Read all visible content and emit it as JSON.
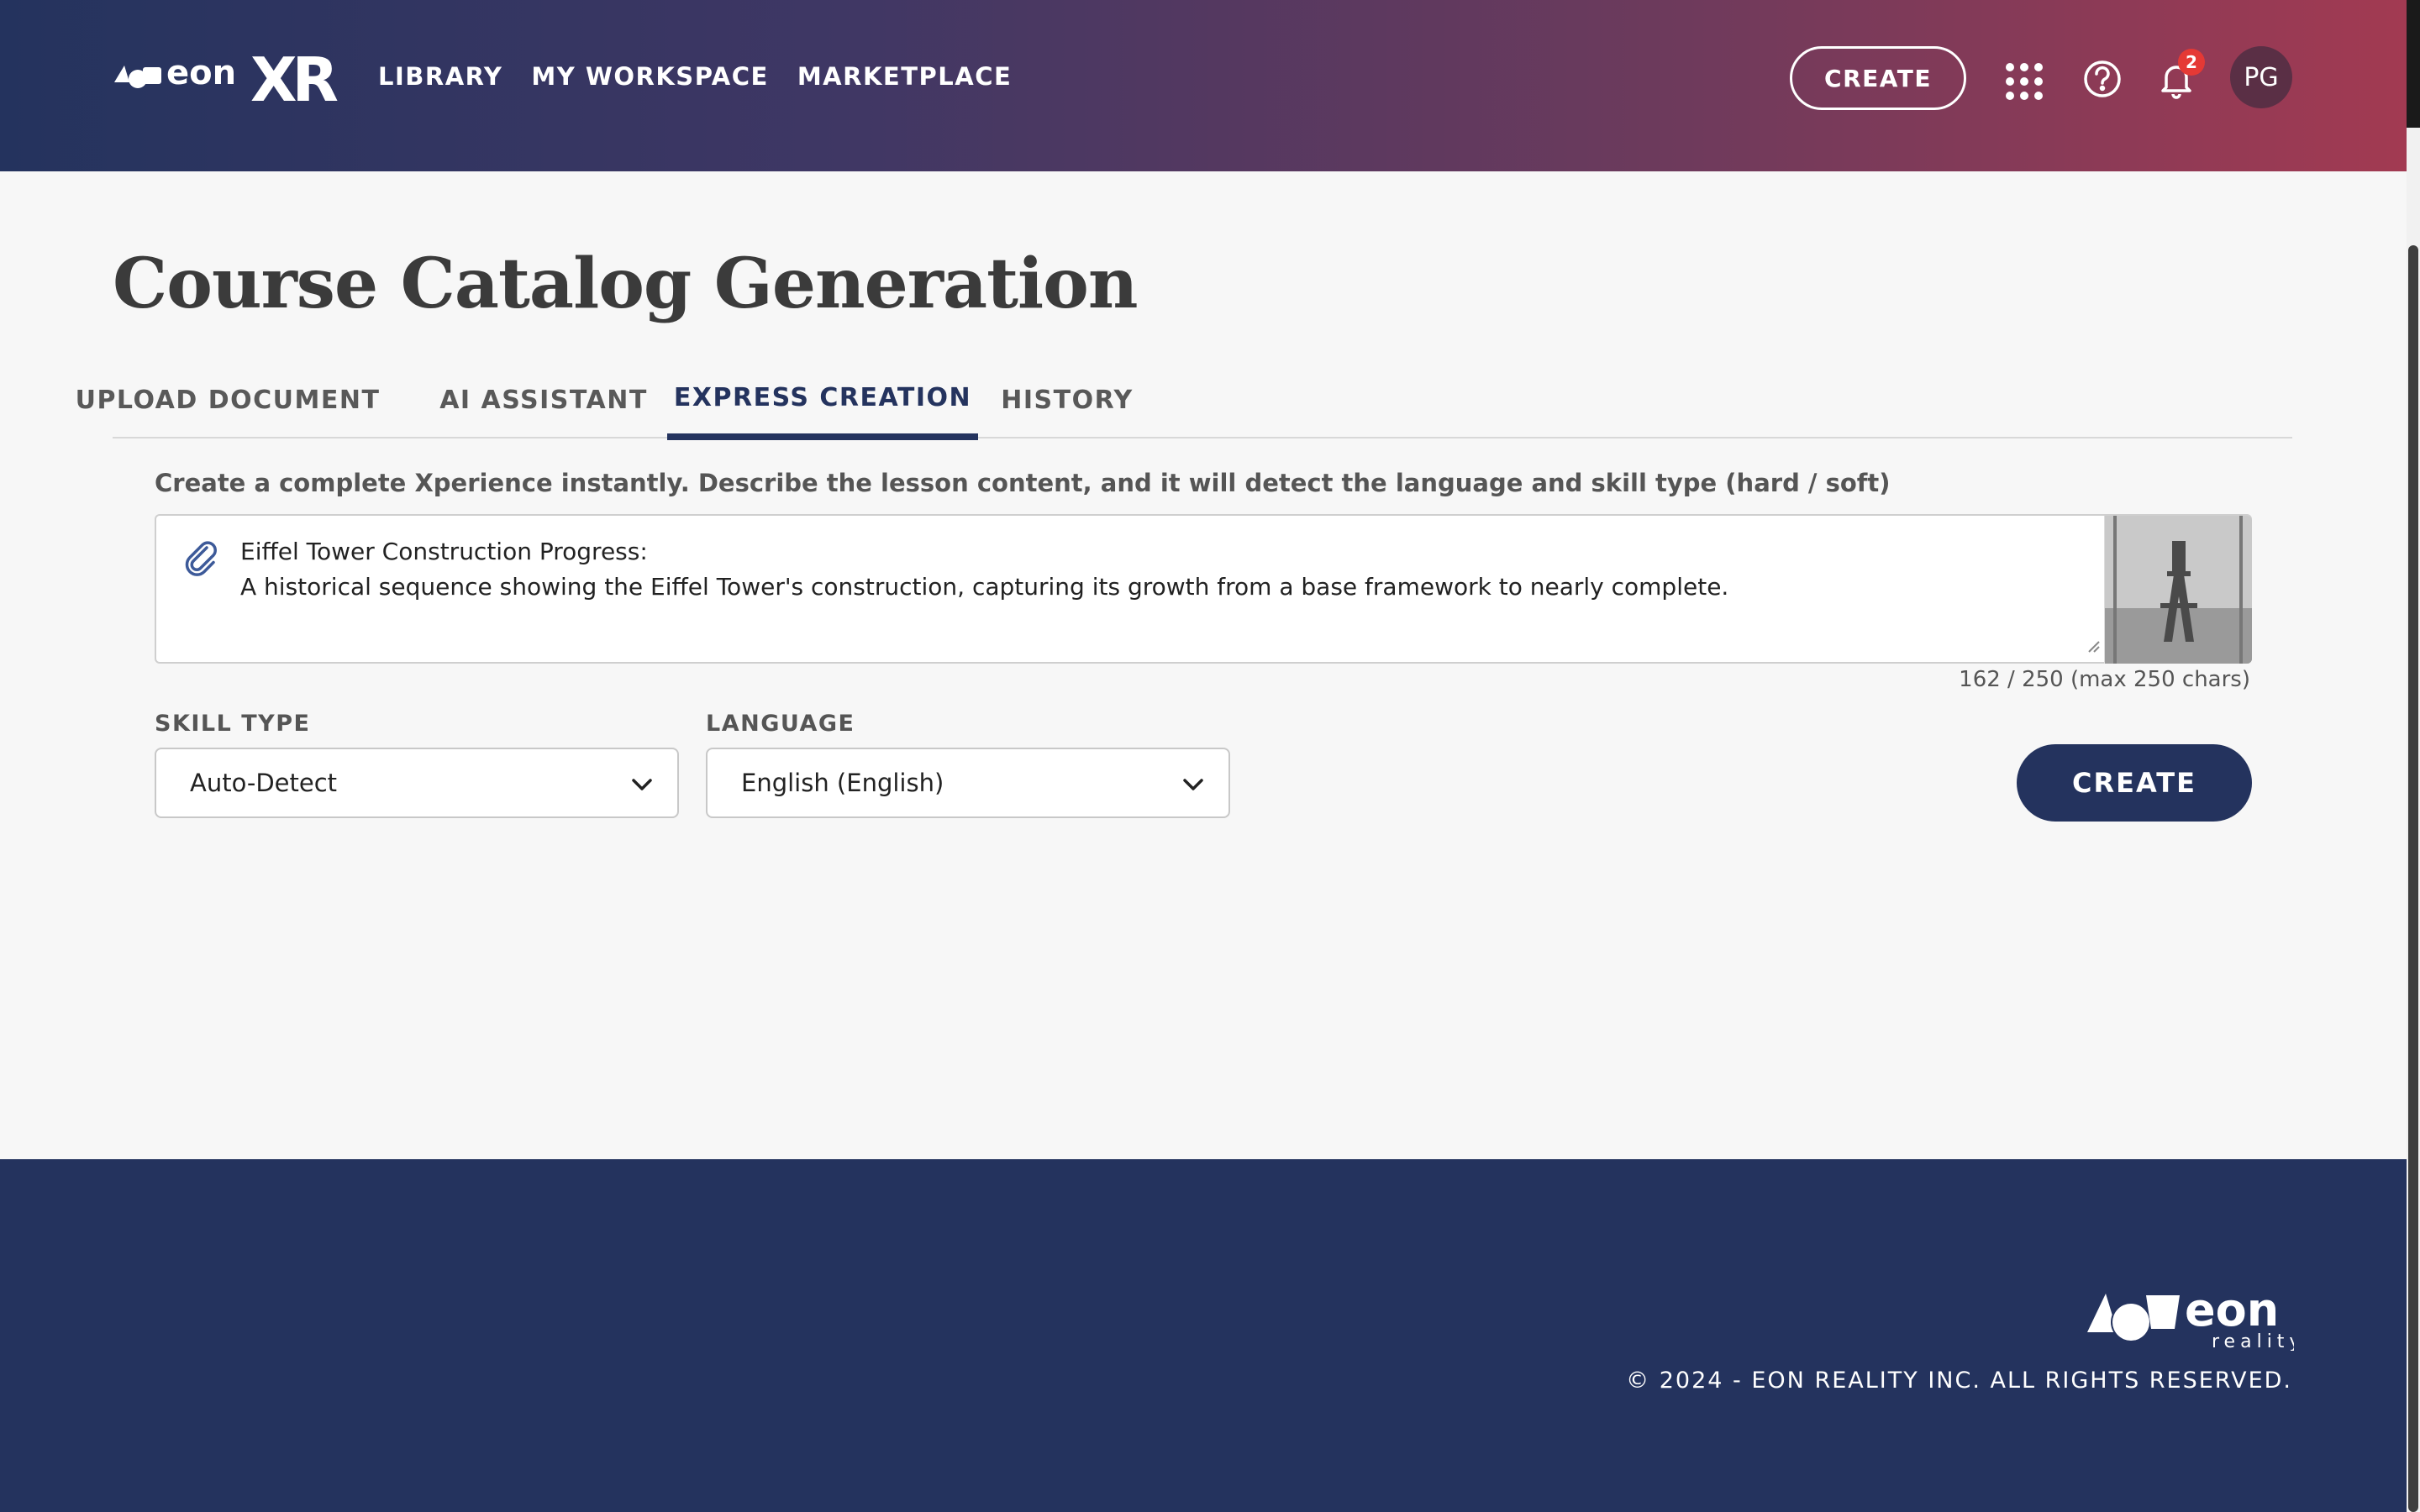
{
  "header": {
    "logo_icon": "eon-xr-logo",
    "nav": [
      "LIBRARY",
      "MY WORKSPACE",
      "MARKETPLACE"
    ],
    "create_label": "CREATE",
    "icons": [
      "apps-grid-icon",
      "help-icon",
      "bell-icon"
    ],
    "notification_count": "2",
    "avatar_initials": "PG"
  },
  "page": {
    "title": "Course Catalog Generation",
    "tabs": [
      {
        "label": "UPLOAD DOCUMENT",
        "active": false
      },
      {
        "label": "AI ASSISTANT",
        "active": false
      },
      {
        "label": "EXPRESS CREATION",
        "active": true
      },
      {
        "label": "HISTORY",
        "active": false
      }
    ],
    "description": "Create a complete Xperience instantly. Describe the lesson content, and it will detect the language and skill type (hard / soft)",
    "prompt": {
      "value": "Eiffel Tower Construction Progress:\nA historical sequence showing the Eiffel Tower's construction, capturing its growth from a base framework to nearly complete.",
      "char_count": "162 / 250 (max 250 chars)"
    },
    "skill_type": {
      "label": "SKILL TYPE",
      "value": "Auto-Detect"
    },
    "language": {
      "label": "LANGUAGE",
      "value": "English (English)"
    },
    "create_label": "CREATE"
  },
  "footer": {
    "logo_icon": "eon-reality-logo",
    "copyright": "© 2024 - EON REALITY INC. ALL RIGHTS RESERVED."
  },
  "colors": {
    "primary": "#24335e",
    "header_gradient_end": "#a23a52",
    "badge": "#e53935"
  }
}
